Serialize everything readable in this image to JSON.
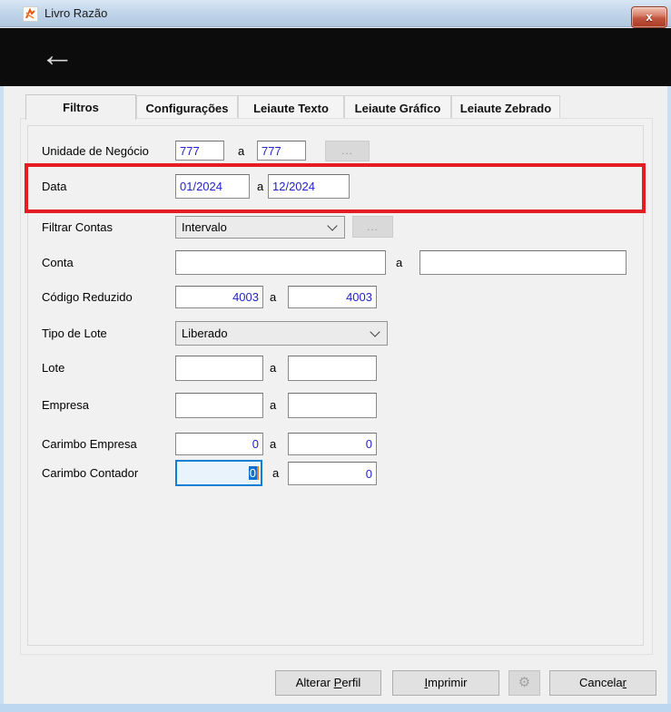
{
  "window": {
    "title": "Livro Razão",
    "close_glyph": "x"
  },
  "toolbar": {
    "back_glyph": "←"
  },
  "tabs": [
    {
      "label": "Filtros",
      "active": true
    },
    {
      "label": "Configurações",
      "active": false
    },
    {
      "label": "Leiaute Texto",
      "active": false
    },
    {
      "label": "Leiaute Gráfico",
      "active": false
    },
    {
      "label": "Leiaute Zebrado",
      "active": false
    }
  ],
  "form": {
    "separator": "a",
    "browse_label": "...",
    "rows": [
      {
        "label": "Unidade de Negócio",
        "from": "777",
        "to": "777"
      },
      {
        "label": "Data",
        "from": "01/2024",
        "to": "12/2024"
      },
      {
        "label": "Filtrar Contas",
        "value": "Intervalo"
      },
      {
        "label": "Conta",
        "from": "",
        "to": ""
      },
      {
        "label": "Código Reduzido",
        "from": "4003",
        "to": "4003"
      },
      {
        "label": "Tipo de Lote",
        "value": "Liberado"
      },
      {
        "label": "Lote",
        "from": "",
        "to": ""
      },
      {
        "label": "Empresa",
        "from": "",
        "to": ""
      },
      {
        "label": "Carimbo Empresa",
        "from": "0",
        "to": "0"
      },
      {
        "label": "Carimbo Contador",
        "from": "0",
        "to": "0"
      }
    ]
  },
  "annotation": {
    "shape": "red-rectangle",
    "color": "#e51c23",
    "highlights": "Data"
  },
  "footer": {
    "alterar_perfil": {
      "pre": "Alterar ",
      "key": "P",
      "post": "erfil"
    },
    "imprimir": {
      "pre": "",
      "key": "I",
      "post": "mprimir"
    },
    "gear": {
      "icon": "gear-icon",
      "glyph": "⚙"
    },
    "cancelar": {
      "pre": "Cancela",
      "key": "r",
      "post": ""
    }
  }
}
